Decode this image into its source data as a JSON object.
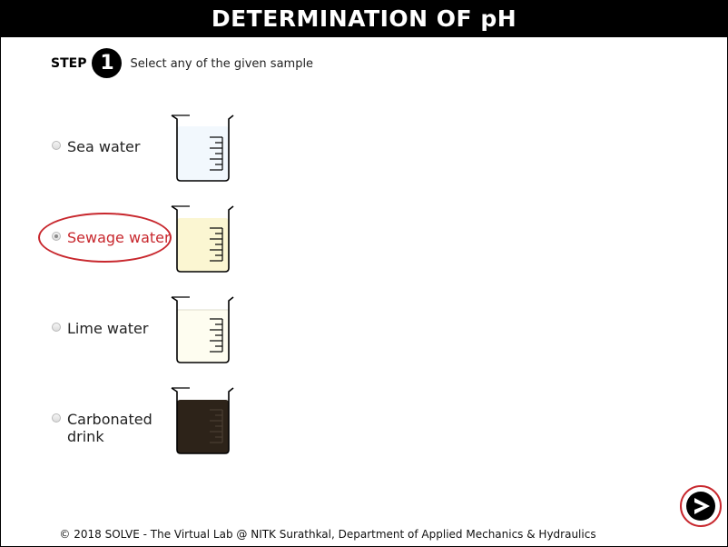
{
  "header": {
    "title": "DETERMINATION OF pH"
  },
  "step": {
    "label": "STEP",
    "number": "1",
    "instruction": "Select any of the given sample"
  },
  "samples": [
    {
      "label": "Sea water",
      "selected": false,
      "liquid_color": "#f2f8fd",
      "icon": "beaker-icon"
    },
    {
      "label": "Sewage water",
      "selected": true,
      "liquid_color": "#fbf6d2",
      "icon": "beaker-icon"
    },
    {
      "label": "Lime water",
      "selected": false,
      "liquid_color": "#fefdf0",
      "icon": "beaker-icon"
    },
    {
      "label": "Carbonated drink",
      "label_line1": "Carbonated",
      "label_line2": "drink",
      "selected": false,
      "liquid_color": "#2d2319",
      "icon": "beaker-icon"
    }
  ],
  "navigation": {
    "next_icon": "arrow-right-icon"
  },
  "colors": {
    "header_bg": "#000000",
    "selection_highlight": "#c8282e"
  },
  "footer": {
    "text": "© 2018 SOLVE - The Virtual Lab @ NITK Surathkal, Department of Applied Mechanics & Hydraulics"
  }
}
